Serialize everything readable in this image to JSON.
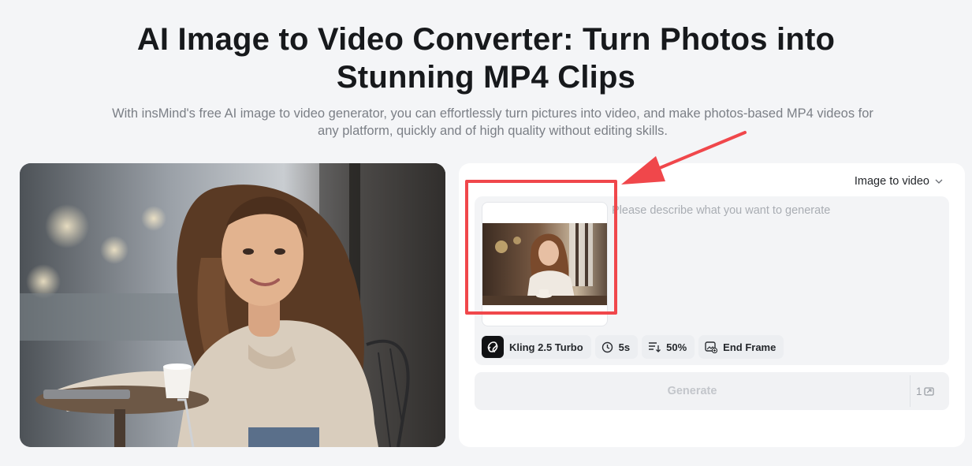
{
  "hero": {
    "title_line1": "AI Image to Video Converter: Turn Photos into",
    "title_line2": "Stunning MP4 Clips",
    "subtitle": "With insMind's free AI image to video generator, you can effortlessly turn pictures into video, and make photos-based MP4 videos for any platform, quickly and of high quality without editing skills."
  },
  "generator": {
    "mode_label": "Image to video",
    "prompt_placeholder": "Please describe what you want to generate",
    "options": {
      "model": "Kling 2.5 Turbo",
      "duration": "5s",
      "strength": "50%",
      "end_frame": "End Frame"
    },
    "generate_label": "Generate",
    "credits": "1"
  },
  "colors": {
    "highlight": "#f0474b",
    "page_bg": "#f4f5f7"
  },
  "icons": [
    "chevron-down-icon",
    "kling-logo-icon",
    "clock-icon",
    "sliders-icon",
    "image-frame-icon",
    "credit-icon",
    "arrow-annotation"
  ]
}
